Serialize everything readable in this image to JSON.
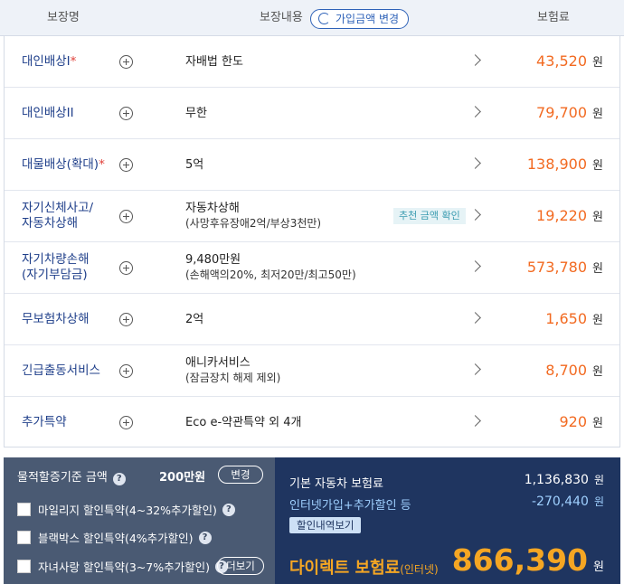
{
  "header": {
    "col_name": "보장명",
    "col_content": "보장내용",
    "change_button": "가입금액 변경",
    "col_premium": "보험료"
  },
  "rows": [
    {
      "name": "대인배상I",
      "required": "*",
      "detail": "자배법 한도",
      "sub": "",
      "price": "43,520",
      "won": "원"
    },
    {
      "name": "대인배상II",
      "required": "",
      "detail": "무한",
      "sub": "",
      "price": "79,700",
      "won": "원"
    },
    {
      "name": "대물배상(확대)",
      "required": "*",
      "detail": "5억",
      "sub": "",
      "price": "138,900",
      "won": "원"
    },
    {
      "name": "자기신체사고/\n자동차상해",
      "required": "",
      "detail": "자동차상해",
      "sub": "(사망후유장애2억/부상3천만)",
      "price": "19,220",
      "won": "원",
      "badge": "추천 금액 확인"
    },
    {
      "name": "자기차량손해\n(자기부담금)",
      "required": "",
      "detail": "9,480만원",
      "sub": "(손해액의20%, 최저20만/최고50만)",
      "price": "573,780",
      "won": "원"
    },
    {
      "name": "무보험차상해",
      "required": "",
      "detail": "2억",
      "sub": "",
      "price": "1,650",
      "won": "원"
    },
    {
      "name": "긴급출동서비스",
      "required": "",
      "detail": "애니카서비스",
      "sub": "(잠금장치 해제 제외)",
      "price": "8,700",
      "won": "원"
    },
    {
      "name": "추가특약",
      "required": "",
      "detail": "Eco e-약관특약 외 4개",
      "sub": "",
      "price": "920",
      "won": "원"
    }
  ],
  "left_panel": {
    "threshold_label": "물적할증기준 금액",
    "threshold_value": "200만원",
    "change_label": "변경",
    "options": [
      {
        "label": "마일리지 할인특약(4~32%추가할인)"
      },
      {
        "label": "블랙박스 할인특약(4%추가할인)"
      },
      {
        "label": "자녀사랑 할인특약(3~7%추가할인)"
      }
    ],
    "more_label": "더보기"
  },
  "right_panel": {
    "base_label": "기본 자동차 보험료",
    "base_value": "1,136,830",
    "discount_label": "인터넷가입+추가할인 등",
    "discount_value": "-270,440",
    "won": "원",
    "detail_button": "할인내역보기",
    "direct_label": "다이렉트 보험료",
    "direct_sub": "(인터넷)",
    "direct_value": "866,390"
  },
  "colors": {
    "accent": "#f26a21",
    "navy": "#1f3560",
    "link": "#1f3f8a",
    "total": "#f5a623"
  }
}
